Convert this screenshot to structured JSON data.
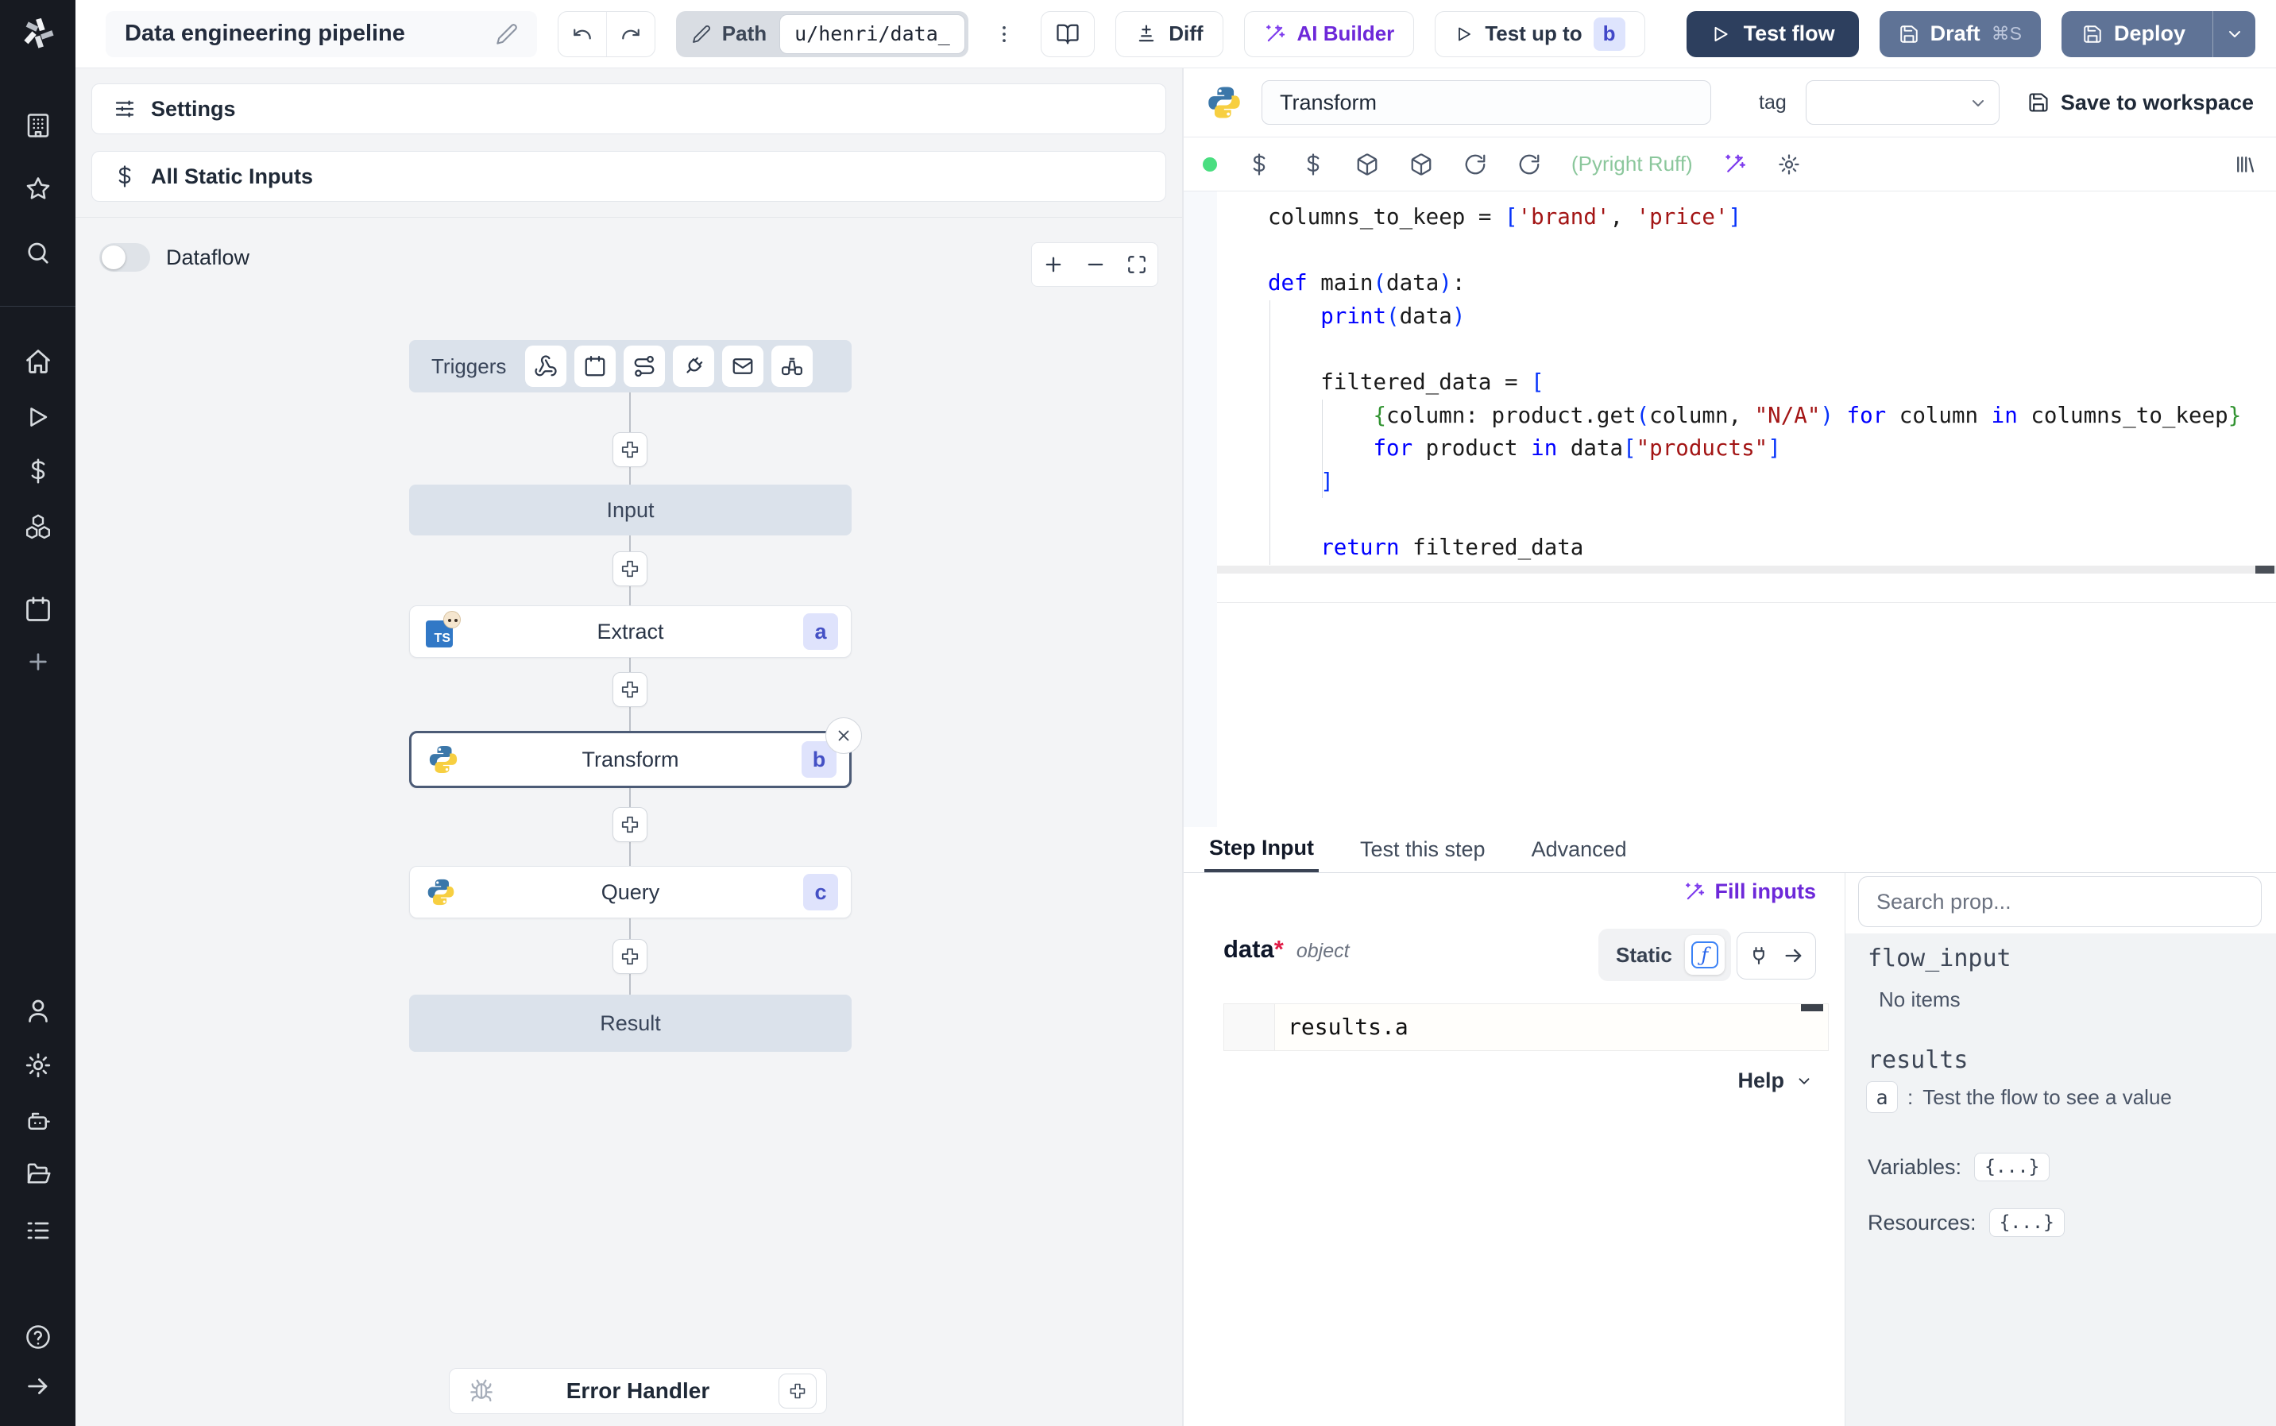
{
  "topbar": {
    "title": "Data engineering pipeline",
    "path_label": "Path",
    "path_value": "u/henri/data_",
    "diff_symbol": "±",
    "diff_label": "Diff",
    "ai_builder_label": "AI Builder",
    "test_up_to_label": "Test up to",
    "test_up_to_badge": "b",
    "test_flow_label": "Test flow",
    "draft_label": "Draft",
    "draft_shortcut": "⌘S",
    "deploy_label": "Deploy"
  },
  "sidebar": {
    "icons": [
      "windmill-logo",
      "company",
      "favorites",
      "search",
      "home",
      "runs",
      "variables",
      "resources",
      "schedules",
      "create",
      "user",
      "settings",
      "workers",
      "folders",
      "audit-logs",
      "help",
      "expand"
    ]
  },
  "flow": {
    "settings_label": "Settings",
    "all_static_inputs_label": "All Static Inputs",
    "dataflow_label": "Dataflow",
    "triggers_label": "Triggers",
    "nodes": {
      "input": {
        "label": "Input"
      },
      "extract": {
        "label": "Extract",
        "badge": "a"
      },
      "transform": {
        "label": "Transform",
        "badge": "b"
      },
      "query": {
        "label": "Query",
        "badge": "c"
      },
      "result": {
        "label": "Result"
      }
    },
    "error_handler_label": "Error Handler"
  },
  "editor": {
    "step_name": "Transform",
    "tag_label": "tag",
    "save_to_workspace_label": "Save to workspace",
    "assistant_label": "(Pyright Ruff)",
    "code_lines": [
      [
        {
          "c": "p",
          "t": "columns_to_keep = "
        },
        {
          "c": "b1",
          "t": "["
        },
        {
          "c": "s",
          "t": "'brand'"
        },
        {
          "c": "p",
          "t": ", "
        },
        {
          "c": "s",
          "t": "'price'"
        },
        {
          "c": "b1",
          "t": "]"
        }
      ],
      [],
      [
        {
          "c": "k",
          "t": "def"
        },
        {
          "c": "p",
          "t": " main"
        },
        {
          "c": "b1",
          "t": "("
        },
        {
          "c": "p",
          "t": "data"
        },
        {
          "c": "b1",
          "t": ")"
        },
        {
          "c": "p",
          "t": ":"
        }
      ],
      [
        {
          "c": "p",
          "t": "    "
        },
        {
          "c": "k",
          "t": "print"
        },
        {
          "c": "b1",
          "t": "("
        },
        {
          "c": "p",
          "t": "data"
        },
        {
          "c": "b1",
          "t": ")"
        }
      ],
      [],
      [
        {
          "c": "p",
          "t": "    filtered_data = "
        },
        {
          "c": "b1",
          "t": "["
        }
      ],
      [
        {
          "c": "p",
          "t": "        "
        },
        {
          "c": "b2",
          "t": "{"
        },
        {
          "c": "p",
          "t": "column: product.get"
        },
        {
          "c": "b1",
          "t": "("
        },
        {
          "c": "p",
          "t": "column, "
        },
        {
          "c": "s",
          "t": "\"N/A\""
        },
        {
          "c": "b1",
          "t": ")"
        },
        {
          "c": "p",
          "t": " "
        },
        {
          "c": "k",
          "t": "for"
        },
        {
          "c": "p",
          "t": " column "
        },
        {
          "c": "k",
          "t": "in"
        },
        {
          "c": "p",
          "t": " columns_to_keep"
        },
        {
          "c": "b2",
          "t": "}"
        }
      ],
      [
        {
          "c": "p",
          "t": "        "
        },
        {
          "c": "k",
          "t": "for"
        },
        {
          "c": "p",
          "t": " product "
        },
        {
          "c": "k",
          "t": "in"
        },
        {
          "c": "p",
          "t": " data"
        },
        {
          "c": "b1",
          "t": "["
        },
        {
          "c": "s",
          "t": "\"products\""
        },
        {
          "c": "b1",
          "t": "]"
        }
      ],
      [
        {
          "c": "p",
          "t": "    "
        },
        {
          "c": "b1",
          "t": "]"
        }
      ],
      [],
      [
        {
          "c": "p",
          "t": "    "
        },
        {
          "c": "k",
          "t": "return"
        },
        {
          "c": "p",
          "t": " filtered_data"
        }
      ]
    ]
  },
  "tabs": [
    {
      "label": "Step Input",
      "active": true
    },
    {
      "label": "Test this step",
      "active": false
    },
    {
      "label": "Advanced",
      "active": false
    }
  ],
  "step_input": {
    "fill_inputs_label": "Fill inputs",
    "field_name": "data",
    "required_marker": "*",
    "field_type": "object",
    "static_label": "Static",
    "fx_glyph": "ƒ",
    "expression": "results.a",
    "help_label": "Help"
  },
  "props": {
    "search_placeholder": "Search prop...",
    "flow_input_label": "flow_input",
    "no_items_label": "No items",
    "results_label": "results",
    "result_items": [
      {
        "key": "a",
        "separator": ":",
        "hint": "Test the flow to see a value"
      }
    ],
    "variables_label": "Variables:",
    "variables_value": "{...}",
    "resources_label": "Resources:",
    "resources_value": "{...}"
  },
  "colors": {
    "accent_navy": "#2d3f5e",
    "accent_slate": "#5f7396",
    "accent_purple": "#6d28d9",
    "badge_bg": "#dfe3fc",
    "badge_text": "#4450c5",
    "assistant_green": "#8bc79c",
    "status_dot_green": "#4ade80",
    "canvas_bg": "#f3f4f6",
    "node_gray_bg": "#dbe2eb",
    "sidebar_bg": "#171a21"
  }
}
